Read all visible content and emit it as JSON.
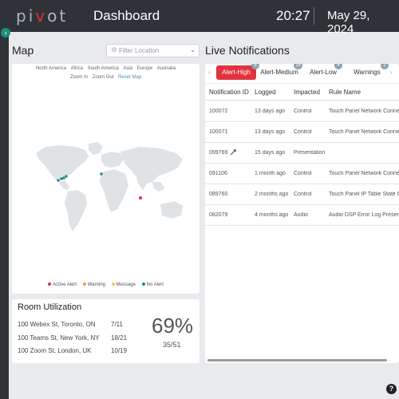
{
  "header": {
    "logo": "pivot",
    "title": "Dashboard",
    "time": "20:27",
    "date": "May 29, 2024"
  },
  "colors": {
    "topbar": "#2f3337",
    "accent_red": "#e0323f",
    "accent_green": "#1e8f7a",
    "background": "#e9eaed"
  },
  "map": {
    "title": "Map",
    "filter_placeholder": "Filter Location",
    "regions": [
      "North America",
      "Africa",
      "South America",
      "Asia",
      "Europe",
      "Australia"
    ],
    "zoom_in": "Zoom In",
    "zoom_out": "Zoom Out",
    "reset_map": "Reset Map",
    "legend": [
      {
        "label": "Active Alert",
        "color": "#e0323f"
      },
      {
        "label": "Warning",
        "color": "#f0a030"
      },
      {
        "label": "Message",
        "color": "#f2c94c"
      },
      {
        "label": "No Alert",
        "color": "#1e8f7a"
      }
    ]
  },
  "room_utilization": {
    "title": "Room Utilization",
    "rows": [
      {
        "location": "100 Webex St, Toronto, ON",
        "value": "7/11"
      },
      {
        "location": "100 Teams St, New York, NY",
        "value": "18/21"
      },
      {
        "location": "100 Zoom St, London, UK",
        "value": "10/19"
      }
    ],
    "percent": "69%",
    "total": "35/51"
  },
  "notifications": {
    "title": "Live Notifications",
    "tabs": [
      {
        "label": "Alert-High",
        "badge": "6"
      },
      {
        "label": "Alert-Medium",
        "badge": "14"
      },
      {
        "label": "Alert-Low",
        "badge": "4"
      },
      {
        "label": "Warnings",
        "badge": "2"
      }
    ],
    "columns": [
      "Notification ID",
      "Logged",
      "Impacted",
      "Rule Name"
    ],
    "rows": [
      {
        "id": "100072",
        "logged": "13 days ago",
        "impacted": "Control",
        "rule": "Touch Panel Network Connection"
      },
      {
        "id": "100071",
        "logged": "13 days ago",
        "impacted": "Control",
        "rule": "Touch Panel Network Connection"
      },
      {
        "id": "099769",
        "logged": "15 days ago",
        "impacted": "Presentation",
        "rule": ""
      },
      {
        "id": "091106",
        "logged": "1 month ago",
        "impacted": "Control",
        "rule": "Touch Panel Network Connection"
      },
      {
        "id": "089760",
        "logged": "2 months ago",
        "impacted": "Control",
        "rule": "Touch Panel IP Table State Offline"
      },
      {
        "id": "082079",
        "logged": "4 months ago",
        "impacted": "Audio",
        "rule": "Audio DSP Error Log Present"
      }
    ]
  },
  "help": "?"
}
